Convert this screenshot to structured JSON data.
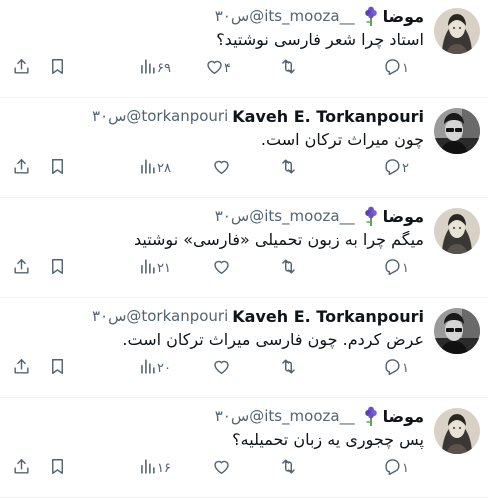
{
  "tweets": [
    {
      "name": "موضا",
      "handle": "@its_mooza__",
      "time": "۳۰س",
      "text": "استاد چرا شعر فارسی نوشتید؟",
      "replies": "۱",
      "likes": "۴",
      "views": "۶۹",
      "avatar": "woman",
      "emoji": "flower"
    },
    {
      "name": "Kaveh E. Torkanpouri",
      "handle": "@torkanpouri",
      "time": "۳۰س",
      "text": "چون میراث ترکان است.",
      "replies": "۲",
      "likes": "",
      "views": "۲۸",
      "avatar": "man",
      "emoji": ""
    },
    {
      "name": "موضا",
      "handle": "@its_mooza__",
      "time": "۳۰س",
      "text": "میگم چرا به زبون تحمیلی «فارسی» نوشتید",
      "replies": "۱",
      "likes": "",
      "views": "۲۱",
      "avatar": "woman",
      "emoji": "flower"
    },
    {
      "name": "Kaveh E. Torkanpouri",
      "handle": "@torkanpouri",
      "time": "۳۰س",
      "text": "عرض کردم. چون فارسی میراث ترکان است.",
      "replies": "۱",
      "likes": "",
      "views": "۲۰",
      "avatar": "man",
      "emoji": ""
    },
    {
      "name": "موضا",
      "handle": "@its_mooza__",
      "time": "۳۰س",
      "text": "پس چجوری یه زبان تحمیلیه؟",
      "replies": "۱",
      "likes": "",
      "views": "۱۶",
      "avatar": "woman",
      "emoji": "flower"
    }
  ],
  "icons": {
    "reply": "reply-icon",
    "retweet": "retweet-icon",
    "like": "heart-icon",
    "views": "views-icon",
    "bookmark": "bookmark-icon",
    "share": "share-icon"
  },
  "colors": {
    "text": "#0f1419",
    "muted": "#536471",
    "border": "#eff3f4",
    "emoji": "#6a4fc7"
  }
}
